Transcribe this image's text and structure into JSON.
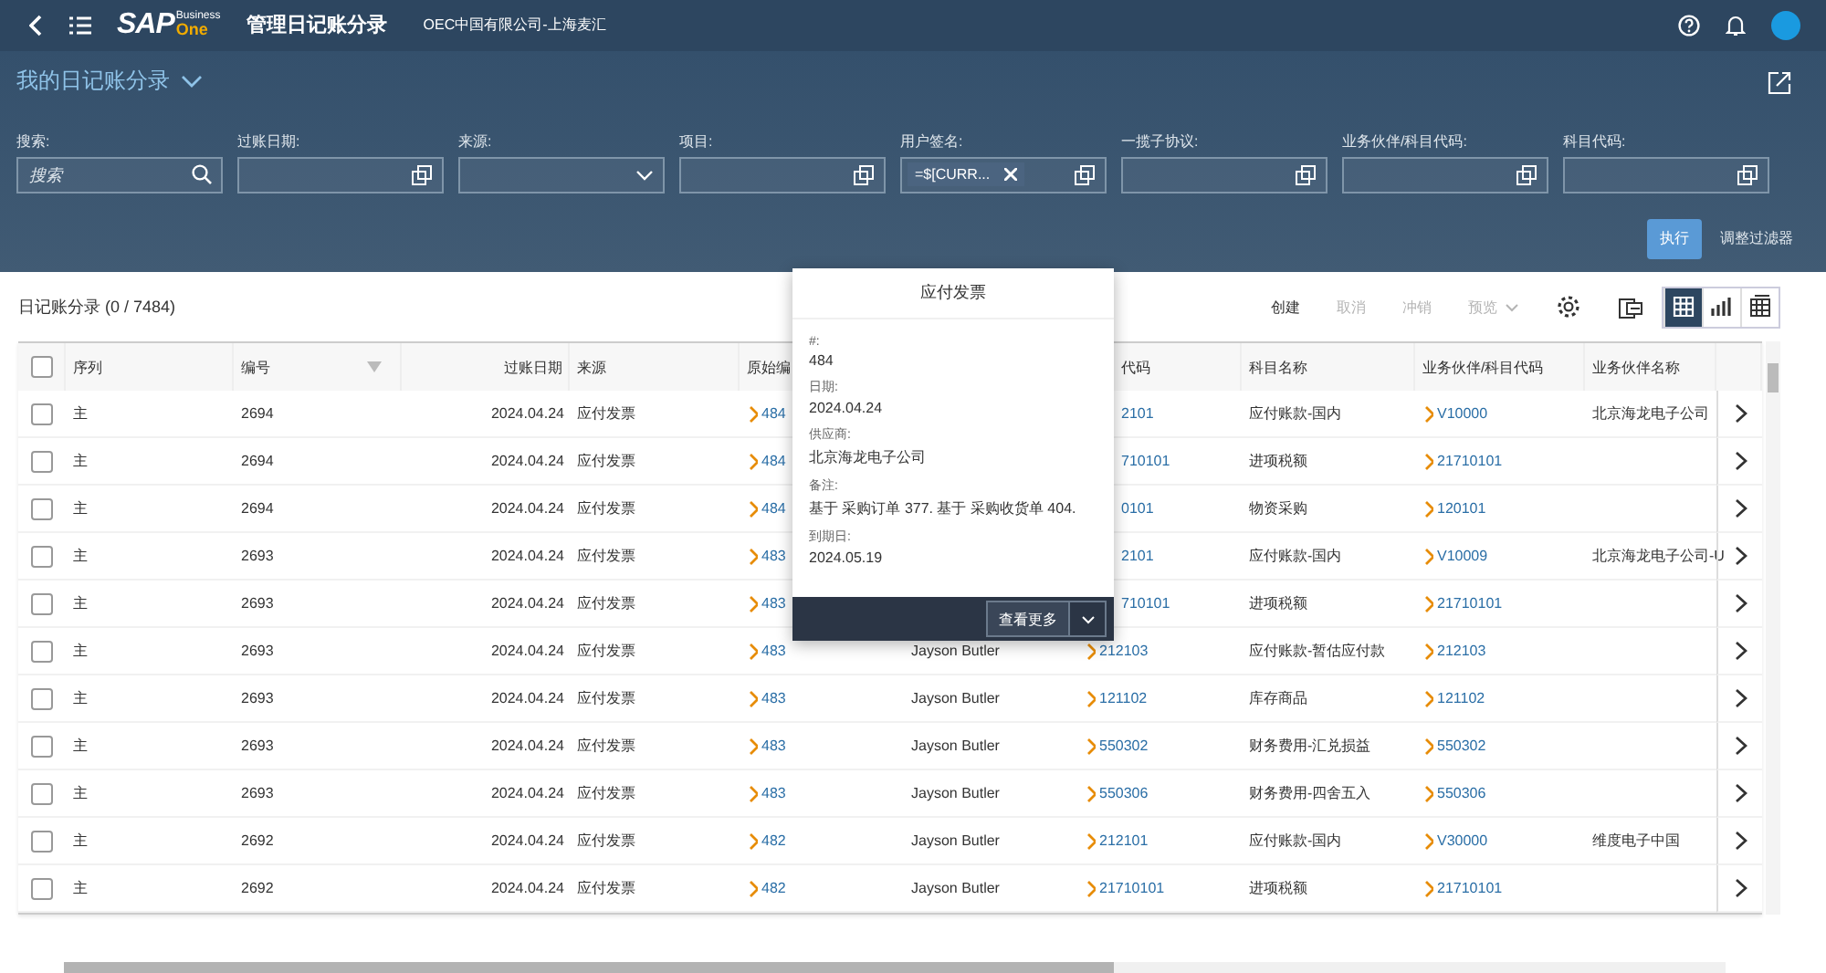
{
  "shell": {
    "logo": {
      "brand": "SAP",
      "line1": "Business",
      "line2": "One"
    },
    "title": "管理日记账分录",
    "company": "OEC中国有限公司-上海麦汇"
  },
  "variant": {
    "title": "我的日记账分录"
  },
  "filters": [
    {
      "label": "搜索:",
      "kind": "search",
      "placeholder": "搜索"
    },
    {
      "label": "过账日期:",
      "kind": "valuehelp"
    },
    {
      "label": "来源:",
      "kind": "dropdown"
    },
    {
      "label": "项目:",
      "kind": "valuehelp"
    },
    {
      "label": "用户签名:",
      "kind": "valuehelp",
      "token": "=$[CURR..."
    },
    {
      "label": "一揽子协议:",
      "kind": "valuehelp"
    },
    {
      "label": "业务伙伴/科目代码:",
      "kind": "valuehelp"
    },
    {
      "label": "科目代码:",
      "kind": "valuehelp"
    }
  ],
  "filter_actions": {
    "go": "执行",
    "adapt": "调整过滤器"
  },
  "table": {
    "title": "日记账分录 (0 / 7484)",
    "actions": [
      {
        "label": "创建",
        "disabled": false,
        "kind": "plain"
      },
      {
        "label": "取消",
        "disabled": true,
        "kind": "plain"
      },
      {
        "label": "冲销",
        "disabled": true,
        "kind": "plain"
      },
      {
        "label": "预览",
        "disabled": true,
        "kind": "menu"
      }
    ],
    "views": [
      {
        "kind": "table",
        "selected": true
      },
      {
        "kind": "chart",
        "selected": false
      },
      {
        "kind": "pivot",
        "selected": false
      }
    ],
    "select_all": {
      "checked": false
    },
    "columns": [
      {
        "label": "序列"
      },
      {
        "label": "编号",
        "filter": true
      },
      {
        "label": "过账日期"
      },
      {
        "label": "来源"
      },
      {
        "label": "原始编"
      },
      {},
      {
        "label": "代码"
      },
      {
        "label": "科目名称"
      },
      {
        "label": "业务伙伴/科目代码"
      },
      {
        "label": "业务伙伴名称"
      }
    ],
    "rows": [
      {
        "checked": false,
        "seq": "主",
        "number": "2694",
        "date": "2024.04.24",
        "source": "应付发票",
        "original": "484",
        "code": {
          "text": "2101",
          "arrow": false
        },
        "account": "应付账款-国内",
        "bp_code": "V10000",
        "bp_name": "北京海龙电子公司"
      },
      {
        "checked": false,
        "seq": "主",
        "number": "2694",
        "date": "2024.04.24",
        "source": "应付发票",
        "original": "484",
        "code": {
          "text": "710101",
          "arrow": false
        },
        "account": "进项税额",
        "bp_code": "21710101"
      },
      {
        "checked": false,
        "seq": "主",
        "number": "2694",
        "date": "2024.04.24",
        "source": "应付发票",
        "original": "484",
        "code": {
          "text": "0101",
          "arrow": false
        },
        "account": "物资采购",
        "bp_code": "120101"
      },
      {
        "checked": false,
        "seq": "主",
        "number": "2693",
        "date": "2024.04.24",
        "source": "应付发票",
        "original": "483",
        "code": {
          "text": "2101",
          "arrow": false
        },
        "account": "应付账款-国内",
        "bp_code": "V10009",
        "bp_name": "北京海龙电子公司-U"
      },
      {
        "checked": false,
        "seq": "主",
        "number": "2693",
        "date": "2024.04.24",
        "source": "应付发票",
        "original": "483",
        "code": {
          "text": "710101",
          "arrow": false
        },
        "account": "进项税额",
        "bp_code": "21710101"
      },
      {
        "checked": false,
        "seq": "主",
        "number": "2693",
        "date": "2024.04.24",
        "source": "应付发票",
        "original": "483",
        "user": "Jayson Butler",
        "code": {
          "text": "212103",
          "arrow": true
        },
        "account": "应付账款-暂估应付款",
        "bp_code": "212103"
      },
      {
        "checked": false,
        "seq": "主",
        "number": "2693",
        "date": "2024.04.24",
        "source": "应付发票",
        "original": "483",
        "user": "Jayson Butler",
        "code": {
          "text": "121102",
          "arrow": true
        },
        "account": "库存商品",
        "bp_code": "121102"
      },
      {
        "checked": false,
        "seq": "主",
        "number": "2693",
        "date": "2024.04.24",
        "source": "应付发票",
        "original": "483",
        "user": "Jayson Butler",
        "code": {
          "text": "550302",
          "arrow": true
        },
        "account": "财务费用-汇兑损益",
        "bp_code": "550302"
      },
      {
        "checked": false,
        "seq": "主",
        "number": "2693",
        "date": "2024.04.24",
        "source": "应付发票",
        "original": "483",
        "user": "Jayson Butler",
        "code": {
          "text": "550306",
          "arrow": true
        },
        "account": "财务费用-四舍五入",
        "bp_code": "550306"
      },
      {
        "checked": false,
        "seq": "主",
        "number": "2692",
        "date": "2024.04.24",
        "source": "应付发票",
        "original": "482",
        "user": "Jayson Butler",
        "code": {
          "text": "212101",
          "arrow": true
        },
        "account": "应付账款-国内",
        "bp_code": "V30000",
        "bp_name": "维度电子中国"
      },
      {
        "checked": false,
        "seq": "主",
        "number": "2692",
        "date": "2024.04.24",
        "source": "应付发票",
        "original": "482",
        "user": "Jayson Butler",
        "code": {
          "text": "21710101",
          "arrow": true
        },
        "account": "进项税额",
        "bp_code": "21710101"
      }
    ]
  },
  "popover": {
    "title": "应付发票",
    "fields": [
      {
        "label": "#:",
        "value": "484"
      },
      {
        "label": "日期:",
        "value": "2024.04.24"
      },
      {
        "label": "供应商:",
        "value": "北京海龙电子公司"
      },
      {
        "label": "备注:",
        "value": "基于 采购订单 377. 基于 采购收货单 404."
      },
      {
        "label": "到期日:",
        "value": "2024.05.19"
      }
    ],
    "more": "查看更多"
  }
}
